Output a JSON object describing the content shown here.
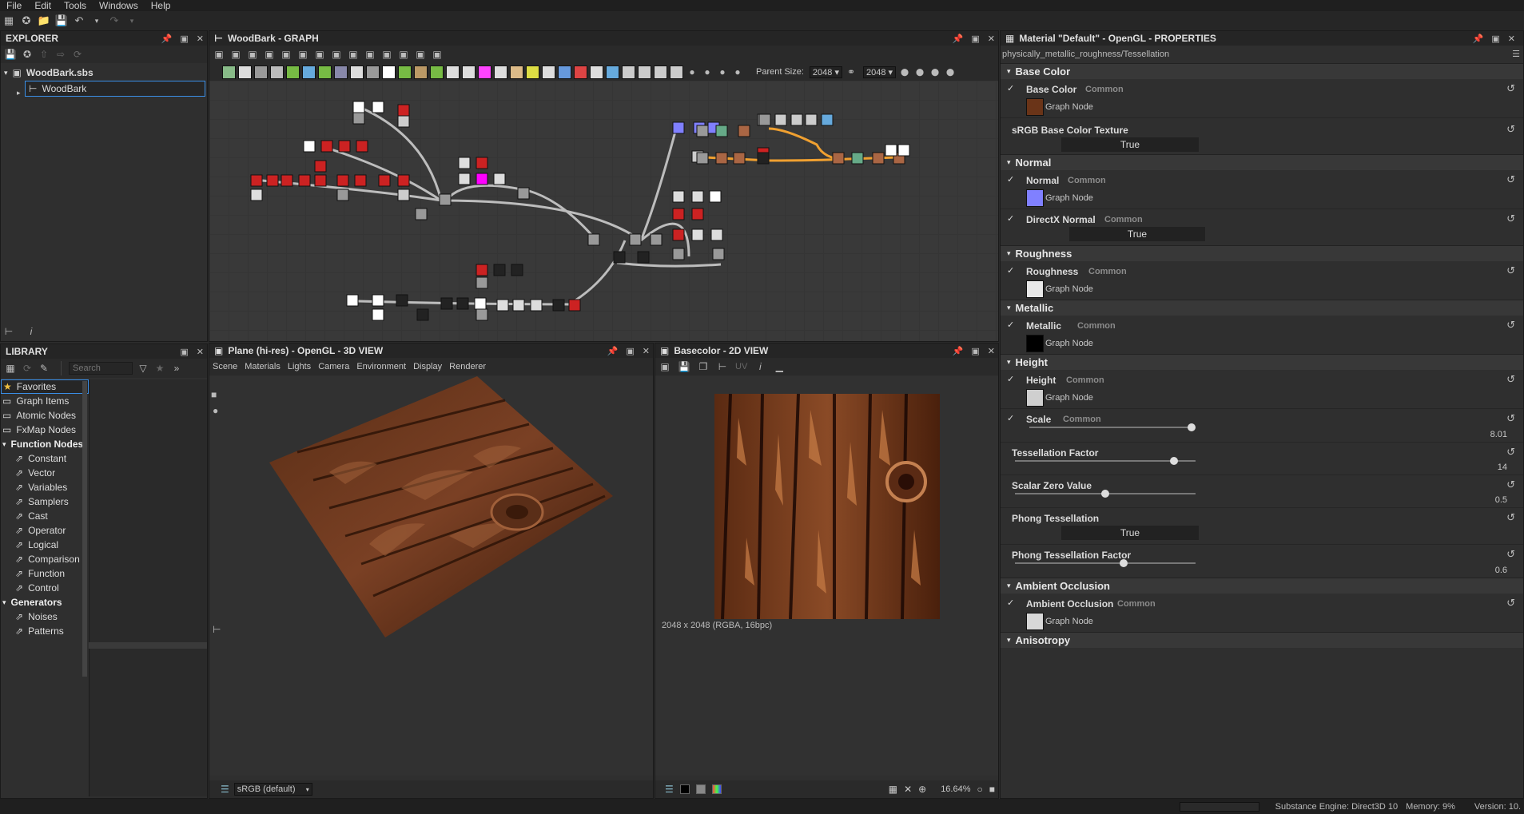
{
  "menu": [
    "File",
    "Edit",
    "Tools",
    "Windows",
    "Help"
  ],
  "explorer": {
    "title": "EXPLORER",
    "package": "WoodBark.sbs",
    "graph": "WoodBark"
  },
  "library": {
    "title": "LIBRARY",
    "search_placeholder": "Search",
    "items": [
      {
        "label": "Favorites",
        "type": "favorite"
      },
      {
        "label": "Graph Items",
        "type": "item"
      },
      {
        "label": "Atomic Nodes",
        "type": "item"
      },
      {
        "label": "FxMap Nodes",
        "type": "item"
      },
      {
        "label": "Function Nodes",
        "type": "cat"
      },
      {
        "label": "Constant",
        "type": "sub"
      },
      {
        "label": "Vector",
        "type": "sub"
      },
      {
        "label": "Variables",
        "type": "sub"
      },
      {
        "label": "Samplers",
        "type": "sub"
      },
      {
        "label": "Cast",
        "type": "sub"
      },
      {
        "label": "Operator",
        "type": "sub"
      },
      {
        "label": "Logical",
        "type": "sub"
      },
      {
        "label": "Comparison",
        "type": "sub"
      },
      {
        "label": "Function",
        "type": "sub"
      },
      {
        "label": "Control",
        "type": "sub"
      },
      {
        "label": "Generators",
        "type": "cat"
      },
      {
        "label": "Noises",
        "type": "sub"
      },
      {
        "label": "Patterns",
        "type": "sub"
      }
    ]
  },
  "graph": {
    "title": "WoodBark - GRAPH",
    "parent_size_label": "Parent Size:",
    "size_a": "2048",
    "size_b": "2048"
  },
  "view3d": {
    "title": "Plane (hi-res) - OpenGL - 3D VIEW",
    "menu": [
      "Scene",
      "Materials",
      "Lights",
      "Camera",
      "Environment",
      "Display",
      "Renderer"
    ],
    "colorspace": "sRGB (default)"
  },
  "view2d": {
    "title": "Basecolor - 2D VIEW",
    "uv_label": "UV",
    "info": "2048 x 2048 (RGBA, 16bpc)",
    "zoom": "16.64%"
  },
  "properties": {
    "title": "Material \"Default\" - OpenGL - PROPERTIES",
    "path": "physically_metallic_roughness/Tessellation",
    "base_color_section": "Base Color",
    "base_color_label": "Base Color",
    "common": "Common",
    "graph_node": "Graph Node",
    "srgb_label": "sRGB Base Color Texture",
    "true_label": "True",
    "normal_section": "Normal",
    "normal_label": "Normal",
    "directx_label": "DirectX Normal",
    "roughness_section": "Roughness",
    "roughness_label": "Roughness",
    "metallic_section": "Metallic",
    "metallic_label": "Metallic",
    "height_section": "Height",
    "height_label": "Height",
    "scale_label": "Scale",
    "scale_value": "8.01",
    "tess_label": "Tessellation Factor",
    "tess_value": "14",
    "scalar_zero_label": "Scalar Zero Value",
    "scalar_zero_value": "0.5",
    "phong_label": "Phong Tessellation",
    "phong_factor_label": "Phong Tessellation Factor",
    "phong_factor_value": "0.6",
    "ao_section": "Ambient Occlusion",
    "ao_label": "Ambient Occlusion",
    "aniso_section": "Anisotropy"
  },
  "status": {
    "engine": "Substance Engine: Direct3D 10",
    "memory": "Memory: 9%",
    "version": "Version: 10."
  },
  "colors": {
    "accent": "#f0a030",
    "selection": "#1e5a9a",
    "normal": "#8080ff",
    "wood": "#7a3f1e"
  }
}
